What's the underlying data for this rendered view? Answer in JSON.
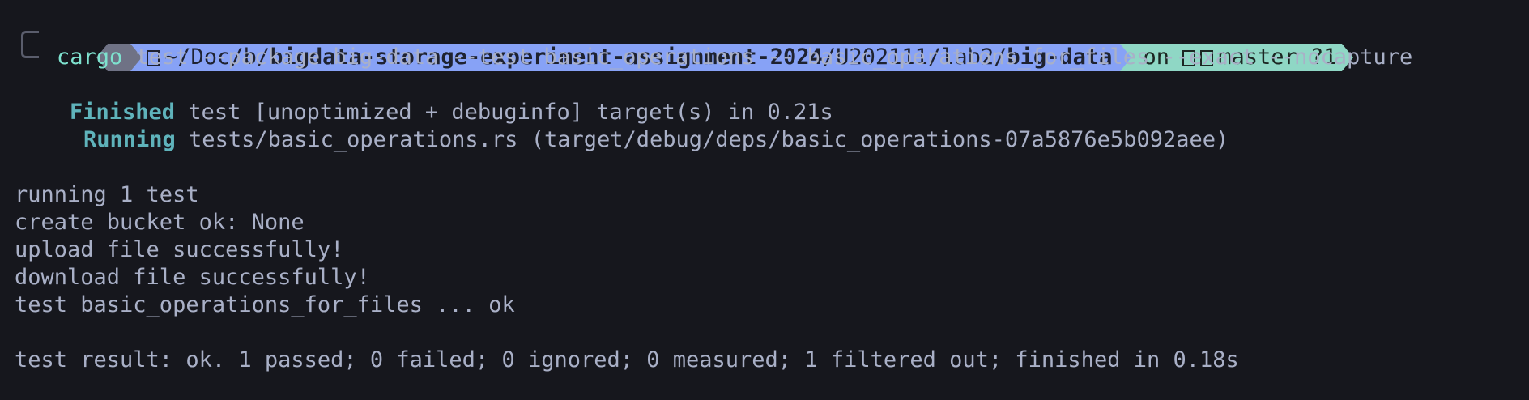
{
  "prompt": {
    "os_icon": "apple-logo-icon",
    "folder_icon": "folder-icon",
    "path_prefix": "~/Doc/b/",
    "path_repo": "bigdata-storage-experiment-assignment-2024",
    "path_mid": "/U202111/lab2/",
    "path_leaf": "big-data",
    "git_on": "on",
    "git_icon": "git-branch-icon",
    "git_branch": "master",
    "git_status": "?1",
    "colors": {
      "os_segment": "#6f7285",
      "path_segment": "#87a2f6",
      "git_segment": "#8fd7c5"
    }
  },
  "command": {
    "name": "cargo",
    "args": " test --package big-data --test basic_operations -- basic_operations_for_files --exact --nocapture"
  },
  "output": {
    "finished_label": "Finished",
    "finished_text": " test [unoptimized + debuginfo] target(s) in 0.21s",
    "running_label": "Running",
    "running_text": " tests/basic_operations.rs (target/debug/deps/basic_operations-07a5876e5b092aee)",
    "lines": [
      "running 1 test",
      "create bucket ok: None",
      "upload file successfully!",
      "download file successfully!",
      "test basic_operations_for_files ... ok"
    ],
    "result": "test result: ok. 1 passed; 0 failed; 0 ignored; 0 measured; 1 filtered out; finished in 0.18s"
  }
}
